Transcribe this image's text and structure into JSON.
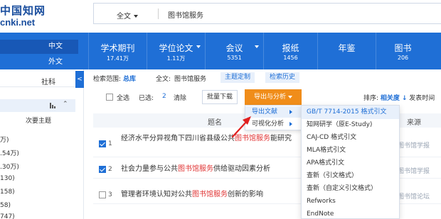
{
  "logo": {
    "line1": "中国知网",
    "line2": "cnki.net"
  },
  "search": {
    "scope": "全文",
    "query": "图书馆服务"
  },
  "nav": {
    "lang_tabs": [
      "中文",
      "外文"
    ],
    "items": [
      {
        "name": "学术期刊",
        "count": "17.41万"
      },
      {
        "name": "学位论文",
        "count": "1.11万"
      },
      {
        "name": "会议",
        "count": "5351"
      },
      {
        "name": "报纸",
        "count": "1456"
      },
      {
        "name": "年鉴",
        "count": ""
      },
      {
        "name": "图书",
        "count": "206"
      }
    ]
  },
  "sidebar": {
    "tab": "社科",
    "collapse": "<",
    "group_chevron": "⌃",
    "sub": "次要主题",
    "counts": [
      "万)",
      ".54万)",
      ".30万)",
      "130)",
      "158)",
      "58)",
      "747)",
      "39)"
    ]
  },
  "scope_row": {
    "label": "检索范围:",
    "scope": "总库",
    "query_prefix": "全文:",
    "query": "图书馆服务",
    "btn1": "主题定制",
    "btn2": "检索历史"
  },
  "toolbar": {
    "select_all": "全选",
    "selected_label": "已选:",
    "selected_count": "2",
    "clear": "清除",
    "batch": "批量下载",
    "export": "导出与分析",
    "sort_label": "排序:",
    "sort_relevance": "相关度",
    "sort_arrow": "↓",
    "sort_time": "发表时间"
  },
  "table": {
    "headers": {
      "title": "题名",
      "source": "来源"
    },
    "rows": [
      {
        "index": "1",
        "checked": true,
        "title_parts": [
          "经济水平分异视角下四川省县级公共",
          "图书馆服务",
          "能研究"
        ],
        "source": "图书馆学报"
      },
      {
        "index": "2",
        "checked": true,
        "title_parts": [
          "社会力量参与公共",
          "图书馆服务",
          "供给驱动因素分析"
        ],
        "source": "图书馆学报"
      },
      {
        "index": "3",
        "checked": false,
        "title_parts": [
          "管理者环境认知对公共",
          "图书馆服务",
          "创新的影响"
        ],
        "source": "图书馆论坛"
      }
    ]
  },
  "export_menu": {
    "items": [
      "导出文献",
      "可视化分析"
    ],
    "formats": [
      "GB/T 7714-2015 格式引文",
      "知网研学（原E-Study)",
      "CAJ-CD 格式引文",
      "MLA格式引文",
      "APA格式引文",
      "查新（引文格式）",
      "查新（自定义引文格式）",
      "Refworks",
      "EndNote"
    ]
  },
  "colors": {
    "primary": "#1f6fd6",
    "export_button": "#f08d1a",
    "highlight": "#e03535",
    "annotation": "#e02020"
  }
}
